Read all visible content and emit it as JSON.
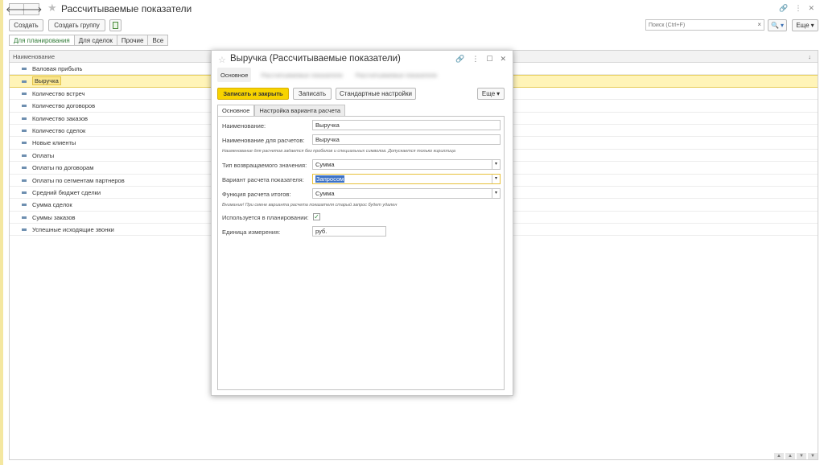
{
  "header": {
    "title": "Рассчитываемые показатели",
    "back": "🡐",
    "forward": "🡒"
  },
  "toolbar": {
    "create": "Создать",
    "create_group": "Создать группу",
    "search_placeholder": "Поиск (Ctrl+F)",
    "search_clear": "×",
    "more": "Еще",
    "dropdown_arrow": "▾"
  },
  "filter_tabs": [
    "Для планирования",
    "Для сделок",
    "Прочие",
    "Все"
  ],
  "list": {
    "column": "Наименование",
    "sort_icon": "↓",
    "items": [
      "Валовая прибыль",
      "Выручка",
      "Количество встреч",
      "Количество договоров",
      "Количество заказов",
      "Количество сделок",
      "Новые клиенты",
      "Оплаты",
      "Оплаты по договорам",
      "Оплаты по сегментам партнеров",
      "Средний бюджет сделки",
      "Сумма сделок",
      "Суммы заказов",
      "Успешные исходящие звонки"
    ],
    "selected": "Выручка"
  },
  "dialog": {
    "title": "Выручка (Рассчитываемые показатели)",
    "tabs": [
      "Основное",
      "Рассчитываемые показатели",
      "Рассчитываемые показатели"
    ],
    "save_close": "Записать и закрыть",
    "save": "Записать",
    "std": "Стандартные настройки",
    "more": "Еще",
    "inner_tabs": [
      "Основное",
      "Настройка варианта расчета"
    ],
    "fields": {
      "name_label": "Наименование:",
      "name_value": "Выручка",
      "calc_name_label": "Наименование для расчетов:",
      "calc_name_value": "Выручка",
      "calc_name_note": "Наименование для расчетов задается без пробелов и специальных символов. Допускается только кириллица",
      "return_type_label": "Тип возвращаемого значения:",
      "return_type_value": "Сумма",
      "variant_label": "Вариант расчета показателя:",
      "variant_value": "Запросом",
      "total_func_label": "Функция расчета итогов:",
      "total_func_value": "Сумма",
      "warning_note": "Внимание! При смене варианта расчета показателя старый запрос будет удален",
      "planning_label": "Используется в планировании:",
      "planning_check": "✓",
      "unit_label": "Единица измерения:",
      "unit_value": "руб."
    }
  }
}
